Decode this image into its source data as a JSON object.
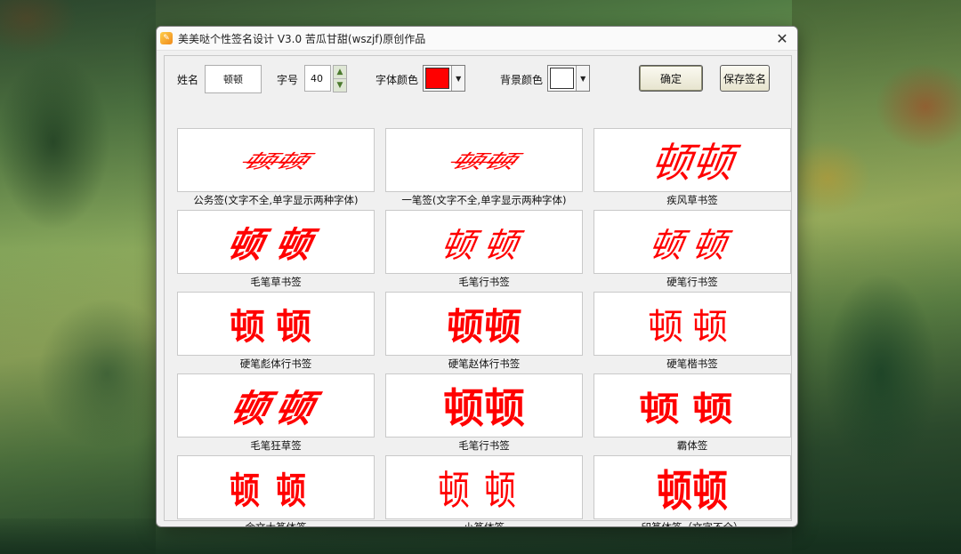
{
  "window": {
    "title": "美美哒个性签名设计 V3.0   苦瓜甘甜(wszjf)原创作品",
    "close_glyph": "✕"
  },
  "form": {
    "name_label": "姓名",
    "name_value": "顿顿",
    "size_label": "字号",
    "size_value": "40",
    "font_color_label": "字体颜色",
    "font_color": "#ff0000",
    "bg_color_label": "背景颜色",
    "bg_color": "#ffffff",
    "confirm_label": "确定",
    "save_label": "保存签名"
  },
  "signatures": [
    {
      "text": "顿顿",
      "caption": "公务签(文字不全,单字显示两种字体)"
    },
    {
      "text": "顿顿",
      "caption": "一笔签(文字不全,单字显示两种字体)"
    },
    {
      "text": "顿顿",
      "caption": "疾风草书签"
    },
    {
      "text": "顿顿",
      "caption": "毛笔草书签"
    },
    {
      "text": "顿顿",
      "caption": "毛笔行书签"
    },
    {
      "text": "顿顿",
      "caption": "硬笔行书签"
    },
    {
      "text": "顿顿",
      "caption": "硬笔彪体行书签"
    },
    {
      "text": "顿顿",
      "caption": "硬笔赵体行书签"
    },
    {
      "text": "顿顿",
      "caption": "硬笔楷书签"
    },
    {
      "text": "顿顿",
      "caption": "毛笔狂草签"
    },
    {
      "text": "顿顿",
      "caption": "毛笔行书签"
    },
    {
      "text": "顿顿",
      "caption": "霸体签"
    },
    {
      "text": "顿顿",
      "caption": "金文大篆体签"
    },
    {
      "text": "顿顿",
      "caption": "小篆体签"
    },
    {
      "text": "顿顿",
      "caption": "印篆体签（文字不全）"
    }
  ]
}
